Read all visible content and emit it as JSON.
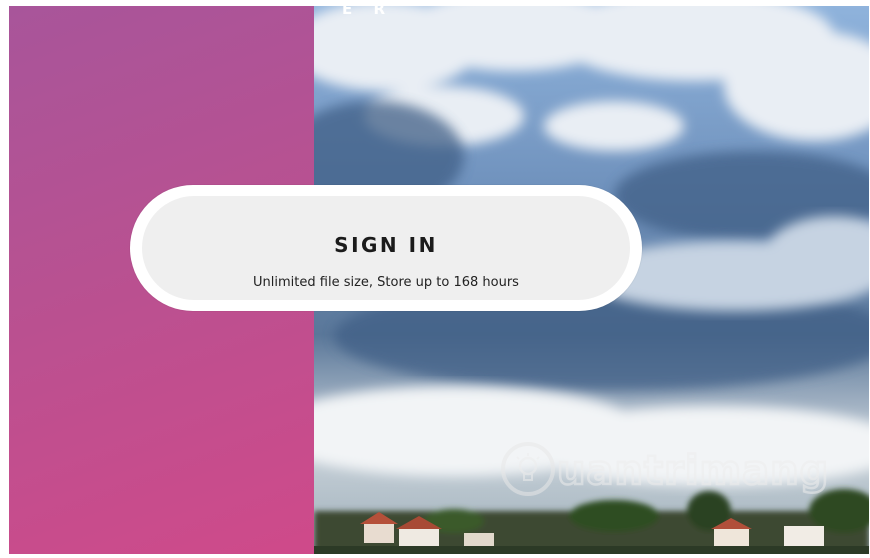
{
  "header": {
    "brand_fragment": "E R"
  },
  "signin": {
    "title": "SIGN IN",
    "subtitle": "Unlimited file size, Store up to 168 hours"
  },
  "watermark": {
    "text": "uantrimang",
    "icon": "lightbulb-icon"
  },
  "colors": {
    "panel_top": "#a8559a",
    "panel_bottom": "#cf4a8a",
    "button_outer": "#ffffff",
    "button_inner": "#efefef",
    "sky": "#7e9cc4"
  }
}
